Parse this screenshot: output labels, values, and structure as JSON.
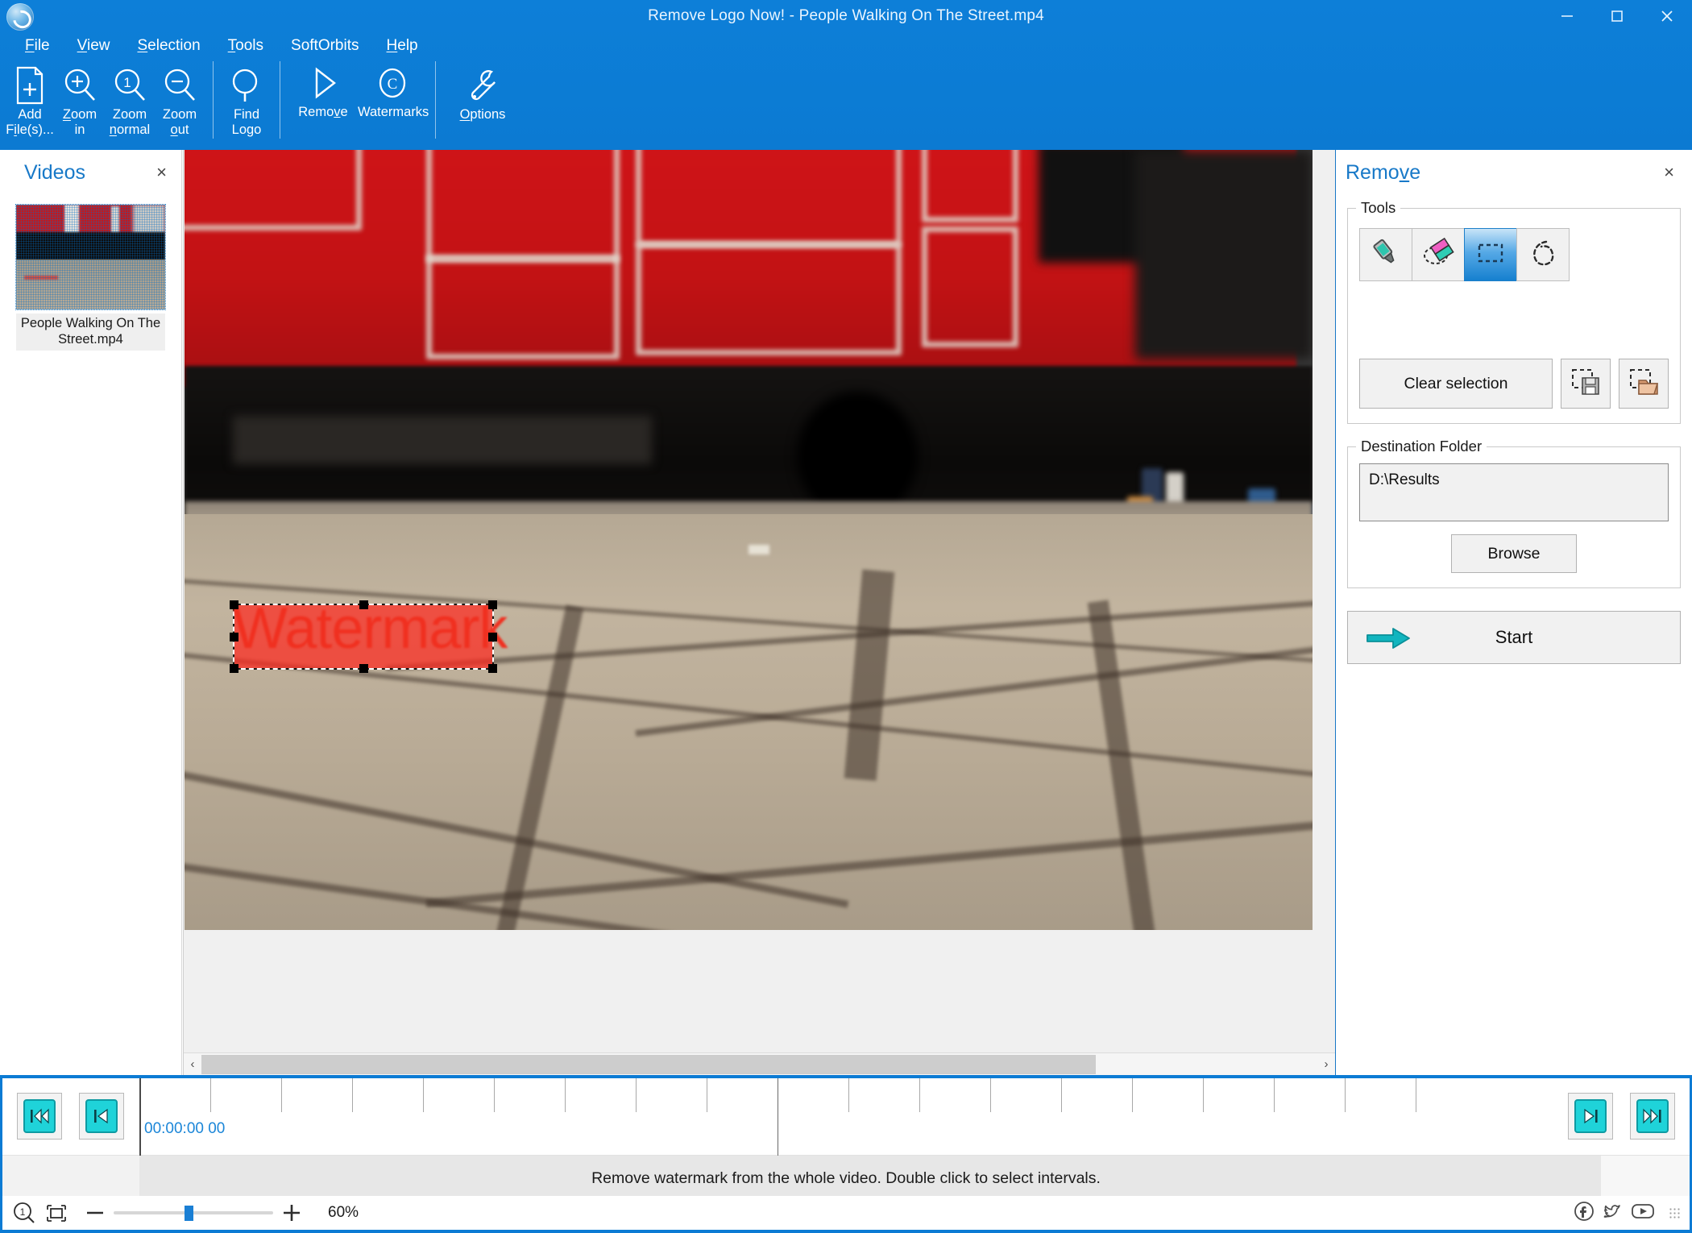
{
  "window": {
    "title": "Remove Logo Now! - People Walking On The Street.mp4",
    "minimize_label": "Minimize",
    "maximize_label": "Maximize",
    "close_label": "Close"
  },
  "menubar": [
    {
      "label": "File",
      "accel": "F"
    },
    {
      "label": "View",
      "accel": "V"
    },
    {
      "label": "Selection",
      "accel": "S"
    },
    {
      "label": "Tools",
      "accel": "T"
    },
    {
      "label": "SoftOrbits",
      "accel": ""
    },
    {
      "label": "Help",
      "accel": "H"
    }
  ],
  "toolbar": {
    "items": [
      {
        "id": "add-files",
        "label": "Add\nFile(s)...",
        "icon": "document-plus-icon"
      },
      {
        "id": "zoom-in",
        "label": "Zoom\nin",
        "icon": "magnifier-plus-icon"
      },
      {
        "id": "zoom-normal",
        "label": "Zoom\nnormal",
        "icon": "magnifier-one-icon"
      },
      {
        "id": "zoom-out",
        "label": "Zoom\nout",
        "icon": "magnifier-minus-icon"
      },
      {
        "id": "find-logo",
        "label": "Find\nLogo",
        "icon": "magnifier-icon"
      },
      {
        "id": "remove",
        "label": "Remove",
        "icon": "play-triangle-icon"
      },
      {
        "id": "watermarks",
        "label": "Watermarks",
        "icon": "copyright-icon"
      },
      {
        "id": "options",
        "label": "Options",
        "icon": "wrench-icon"
      }
    ]
  },
  "videos_panel": {
    "title": "Videos",
    "close_label": "×",
    "items": [
      {
        "name": "People Walking On The Street.mp4",
        "selected": true
      }
    ]
  },
  "canvas": {
    "watermark_text": "Watermark",
    "scroll_left_label": "‹",
    "scroll_right_label": "›"
  },
  "remove_panel": {
    "title": "Remove",
    "close_label": "×",
    "tools_group_label": "Tools",
    "tools": [
      {
        "id": "marker",
        "icon": "marker-pen-icon",
        "active": false
      },
      {
        "id": "eraser",
        "icon": "eraser-icon",
        "active": false
      },
      {
        "id": "rectangle-select",
        "icon": "rectangle-selection-icon",
        "active": true
      },
      {
        "id": "lasso-select",
        "icon": "lasso-selection-icon",
        "active": false
      }
    ],
    "clear_selection_label": "Clear selection",
    "save_selection_icon": "save-selection-icon",
    "load_selection_icon": "load-selection-icon",
    "destination_group_label": "Destination Folder",
    "destination_value": "D:\\Results",
    "destination_placeholder": "",
    "browse_label": "Browse",
    "start_label": "Start",
    "start_icon": "arrow-right-icon",
    "accent_color": "#1879c8"
  },
  "timeline": {
    "nav_first_icon": "skip-to-start-icon",
    "nav_prev_icon": "step-back-icon",
    "nav_next_icon": "step-forward-icon",
    "nav_last_icon": "skip-to-end-icon",
    "current_time": "00:00:00 00",
    "status_message": "Remove watermark from the whole video. Double click to select intervals."
  },
  "statusbar": {
    "zoom_one_icon": "zoom-actual-size-icon",
    "fit_icon": "fit-to-window-icon",
    "zoom_out_label": "−",
    "zoom_in_label": "+",
    "zoom_value": "60%",
    "zoom_slider_percent": 45,
    "social": [
      {
        "id": "facebook",
        "icon": "facebook-icon"
      },
      {
        "id": "twitter",
        "icon": "twitter-icon"
      },
      {
        "id": "youtube",
        "icon": "youtube-icon"
      }
    ],
    "resize_grip_icon": "resize-grip-icon"
  }
}
